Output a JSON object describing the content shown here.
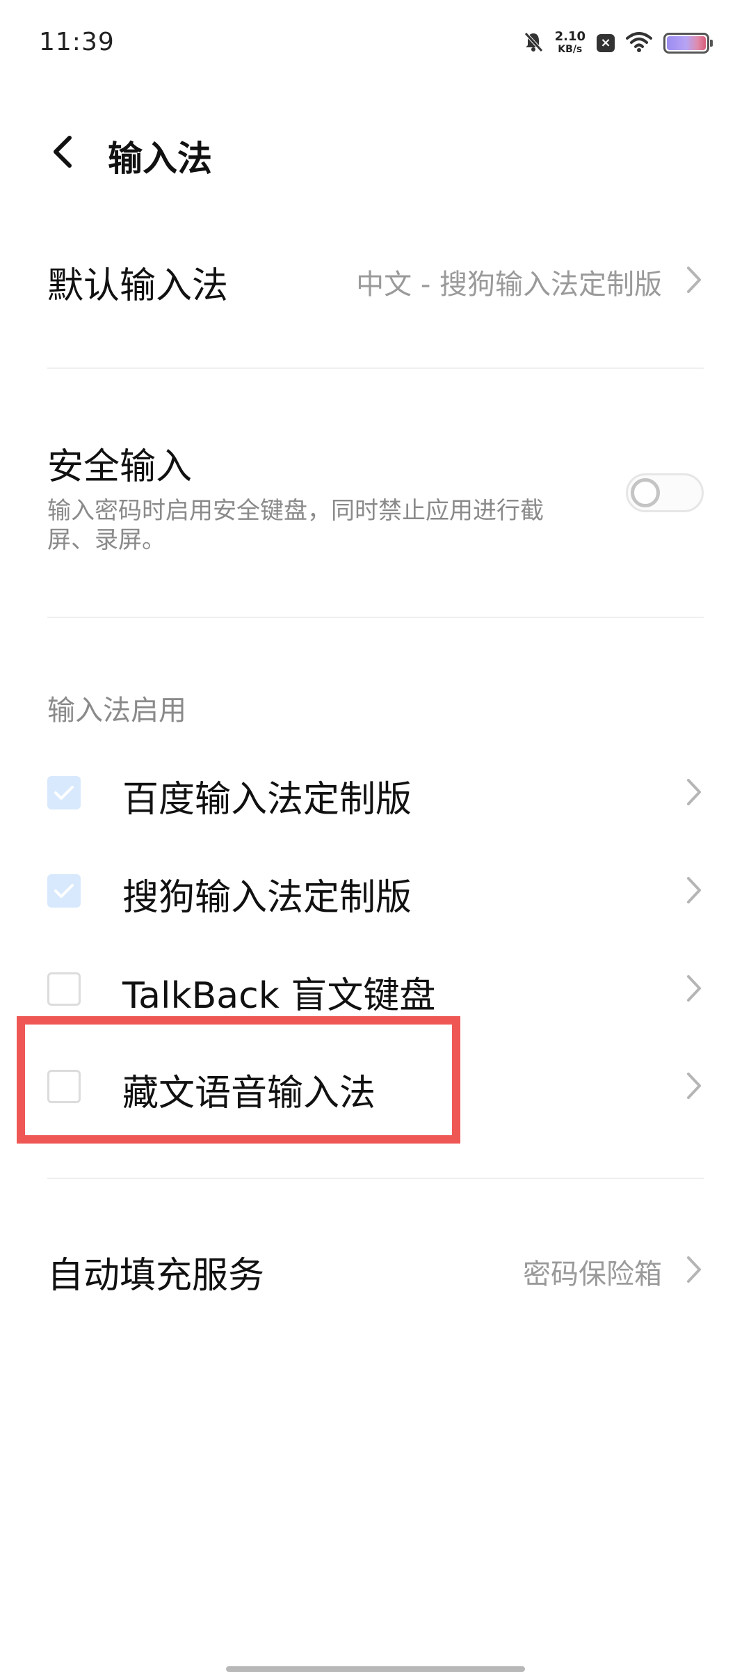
{
  "status_bar": {
    "time": "11:39",
    "net_speed_value": "2.10",
    "net_speed_unit": "KB/s",
    "icons": [
      "mute-icon",
      "sim-x-icon",
      "wifi-icon",
      "battery-icon"
    ]
  },
  "header": {
    "back_icon": "chevron-left-icon",
    "title": "输入法"
  },
  "default_ime": {
    "title": "默认输入法",
    "value": "中文 - 搜狗输入法定制版"
  },
  "secure_input": {
    "title": "安全输入",
    "subtitle": "输入密码时启用安全键盘，同时禁止应用进行截屏、录屏。",
    "enabled": false
  },
  "ime_section": {
    "label": "输入法启用",
    "items": [
      {
        "label": "百度输入法定制版",
        "checked": true
      },
      {
        "label": "搜狗输入法定制版",
        "checked": true
      },
      {
        "label": "TalkBack 盲文键盘",
        "checked": false
      },
      {
        "label": "藏文语音输入法",
        "checked": false
      }
    ]
  },
  "autofill": {
    "title": "自动填充服务",
    "value": "密码保险箱"
  },
  "colors": {
    "highlight": "#ee5753",
    "checkbox_checked_bg": "#d8e9fd",
    "check_mark": "#ffffff",
    "secondary_text": "#9a9a9a"
  }
}
